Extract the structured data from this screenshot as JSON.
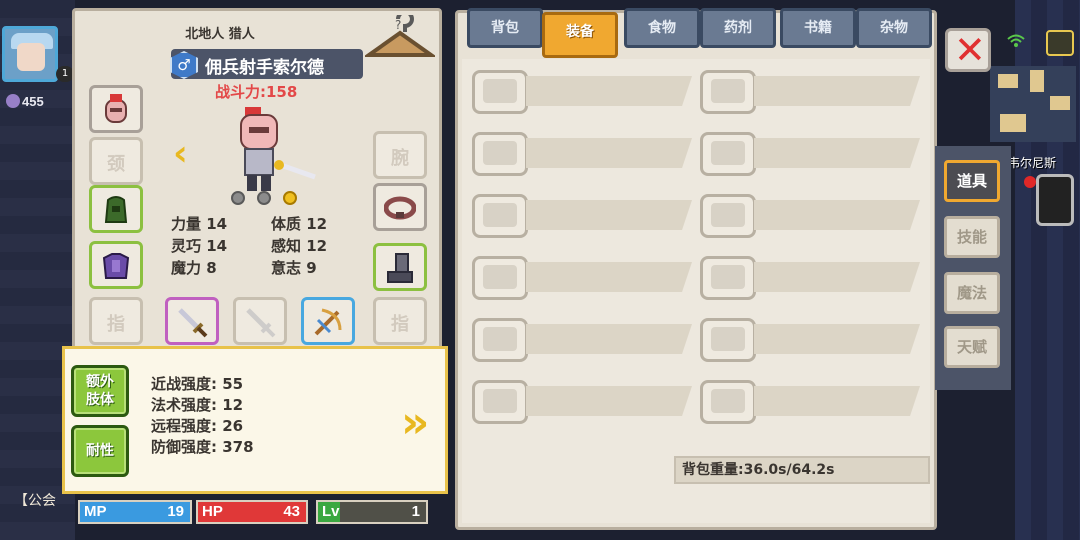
{
  "hud": {
    "level_badge": "1",
    "power_value": "455",
    "guild_tag": "【公会",
    "npc_name": "韦尔尼斯"
  },
  "character": {
    "subtitle": "北地人 猎人",
    "name": "佣兵射手索尔德",
    "combat_power": "战斗力:158",
    "slots": {
      "neck": "颈",
      "wrist": "腕",
      "ring_left": "指",
      "ring_right": "指"
    },
    "stats": [
      {
        "label": "力量",
        "value": "14"
      },
      {
        "label": "体质",
        "value": "12"
      },
      {
        "label": "灵巧",
        "value": "14"
      },
      {
        "label": "感知",
        "value": "12"
      },
      {
        "label": "魔力",
        "value": "8"
      },
      {
        "label": "意志",
        "value": "9"
      }
    ],
    "page_dots": {
      "count": 3,
      "active_index": 2
    }
  },
  "attributes": {
    "buttons": [
      "额外\n肢体",
      "耐性"
    ],
    "lines": [
      "近战强度: 55",
      "法术强度: 12",
      "远程强度: 26",
      "防御强度: 378"
    ]
  },
  "bars": {
    "mp": {
      "label": "MP",
      "value": "19",
      "color": "#3a9ae0"
    },
    "hp": {
      "label": "HP",
      "value": "43",
      "color": "#e03838"
    },
    "lv": {
      "label": "Lv",
      "value": "1",
      "color": "#3aa840",
      "fill_fraction": 0.2
    }
  },
  "inventory": {
    "tabs": [
      {
        "label": "背包",
        "active": false
      },
      {
        "label": "装备",
        "active": true
      },
      {
        "label": "食物",
        "active": false
      },
      {
        "label": "药剂",
        "active": false
      },
      {
        "label": "书籍",
        "active": false
      },
      {
        "label": "杂物",
        "active": false
      }
    ],
    "weight_text": "背包重量:36.0s/64.2s"
  },
  "side_tabs": [
    {
      "label": "道具",
      "active": true
    },
    {
      "label": "技能",
      "active": false
    },
    {
      "label": "魔法",
      "active": false
    },
    {
      "label": "天赋",
      "active": false
    }
  ],
  "colors": {
    "accent": "#f0a830",
    "panel": "#e8e2d6",
    "combat_power": "#e34848"
  }
}
